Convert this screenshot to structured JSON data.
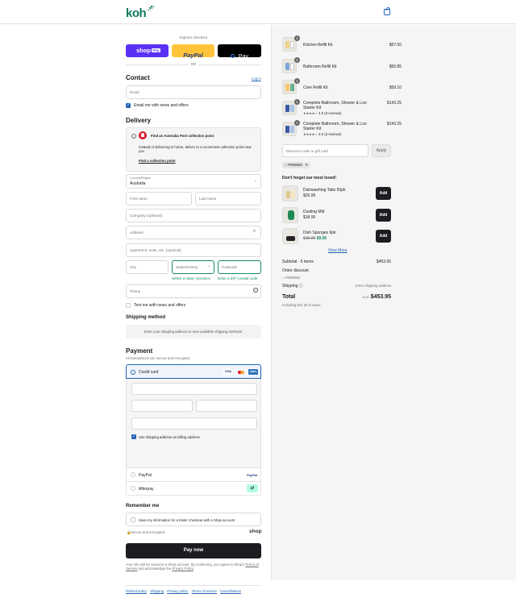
{
  "brand": {
    "logo": "koh",
    "accent": "#0c7a5b",
    "link_color": "#1f63b5"
  },
  "header": {
    "cart_icon": "shopping-bag-icon"
  },
  "express": {
    "label": "Express checkout",
    "shop_pay": "shop",
    "shop_pay_tag": "Pay",
    "paypal": "PayPal",
    "gpay_g": "G",
    "gpay": "Pay",
    "or": "OR"
  },
  "contact": {
    "title": "Contact",
    "login": "Log in",
    "email_placeholder": "Email",
    "newsletter": "Email me with news and offers"
  },
  "delivery": {
    "title": "Delivery",
    "notice": {
      "title": "Find an Australia Post collection point",
      "body": "Instead of delivering to home, deliver to a convenient collection point near you",
      "link": "Find a collection point"
    },
    "country_label": "Country/Region",
    "country_value": "Australia",
    "first_name": "First name",
    "last_name": "Last name",
    "company": "Company (optional)",
    "address": "Address",
    "apartment": "Apartment, suite, etc. (optional)",
    "city": "City",
    "state": "State/territory",
    "postcode": "Postcode",
    "state_error": "Select a state / province",
    "postcode_error": "Enter a ZIP / postal code",
    "phone": "Phone",
    "sms": "Text me with news and offers"
  },
  "shipping": {
    "title": "Shipping method",
    "notice": "Enter your shipping address to view available shipping methods."
  },
  "payment": {
    "title": "Payment",
    "subtitle": "All transactions are secure and encrypted.",
    "credit_card": "Credit card",
    "visa": "VISA",
    "amex": "AMEX",
    "billing_same": "Use shipping address as billing address",
    "paypal": "PayPal",
    "paypal_logo": "PayPal",
    "afterpay": "Afterpay"
  },
  "remember": {
    "title": "Remember me",
    "save_info": "Save my information for a faster checkout with a Shop account",
    "secure": "Secure and encrypted",
    "shop_logo": "shop"
  },
  "pay_button": "Pay now",
  "legal": {
    "text_before": "Your info will be saved to a Shop account. By continuing, you agree to Shop's",
    "terms": "Terms of Service",
    "and": "and acknowledge the",
    "privacy": "Privacy Policy",
    "period": "."
  },
  "footer_links": [
    "Refund policy",
    "Shipping",
    "Privacy policy",
    "Terms of service",
    "Cancellations"
  ],
  "cart": {
    "items": [
      {
        "qty": "1",
        "name": "Kitchen Refill Kit",
        "price": "$57.50",
        "rating": "",
        "reviews": ""
      },
      {
        "qty": "1",
        "name": "Bathroom Refill Kit",
        "price": "$50.85",
        "rating": "",
        "reviews": ""
      },
      {
        "qty": "1",
        "name": "Core Refill Kit",
        "price": "$59.10",
        "rating": "",
        "reviews": ""
      },
      {
        "qty": "1",
        "name": "Complete Bathroom, Shower & Loo Starter Kit",
        "price": "$143.25",
        "rating": "4.0",
        "reviews": "(3 reviews)"
      },
      {
        "qty": "1",
        "name": "Complete Bathroom, Shower & Loo Starter Kit",
        "price": "$143.25",
        "rating": "4.0",
        "reviews": "(3 reviews)"
      }
    ],
    "discount_placeholder": "Discount code or gift card",
    "apply": "Apply",
    "code_tag": "FREEBIE"
  },
  "upsell": {
    "title": "Don't forget our most loved!",
    "add": "Add",
    "view_more": "View More",
    "items": [
      {
        "name": "Dishwashing Tabs 50pk",
        "price": "$26.95",
        "was": ""
      },
      {
        "name": "Dusting Mitt",
        "price": "$18.95",
        "was": ""
      },
      {
        "name": "Dish Sponges 6pk",
        "price": "$9.95",
        "was": "$15.95"
      }
    ]
  },
  "summary": {
    "subtotal_label": "Subtotal · 5 items",
    "subtotal": "$453.95",
    "order_discount": "Order discount",
    "discount_code": "FREEBIE",
    "shipping_label": "Shipping",
    "shipping_value": "Enter shipping address",
    "total_label": "Total",
    "currency": "AUD",
    "total": "$453.95",
    "taxes": "Including $41.26 in taxes"
  }
}
